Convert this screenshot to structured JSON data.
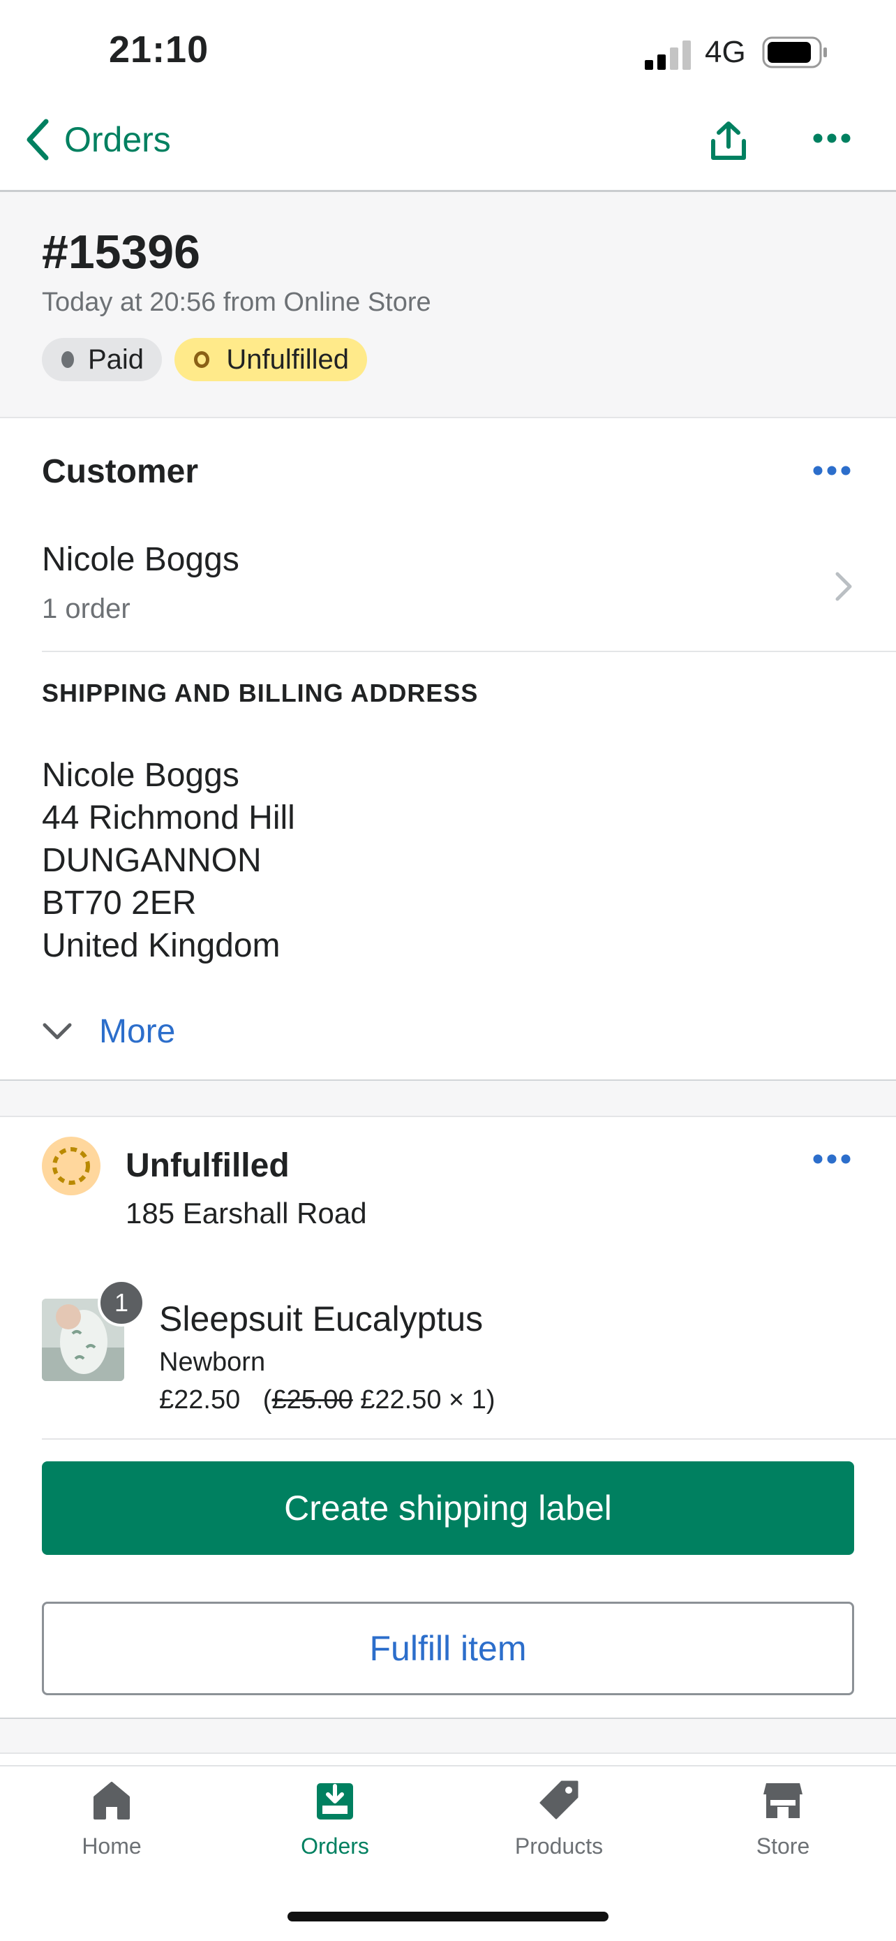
{
  "status_bar": {
    "time": "21:10",
    "network": "4G"
  },
  "nav": {
    "back_label": "Orders"
  },
  "order": {
    "number": "#15396",
    "meta": "Today at 20:56 from Online Store",
    "badges": {
      "paid": "Paid",
      "unfulfilled": "Unfulfilled"
    }
  },
  "customer": {
    "title": "Customer",
    "name": "Nicole Boggs",
    "orders": "1 order",
    "address_heading": "SHIPPING AND BILLING ADDRESS",
    "address": [
      "Nicole Boggs",
      "44 Richmond Hill",
      "DUNGANNON",
      "BT70 2ER",
      "United Kingdom"
    ],
    "more_label": "More"
  },
  "fulfillment": {
    "status": "Unfulfilled",
    "location": "185 Earshall Road",
    "item": {
      "quantity_badge": "1",
      "name": "Sleepsuit Eucalyptus",
      "variant": "Newborn",
      "price": "£22.50",
      "original_price": "£25.00",
      "unit_line": "£22.50 × 1"
    },
    "primary_button": "Create shipping label",
    "secondary_button": "Fulfill item"
  },
  "tabs": [
    {
      "label": "Home",
      "icon": "home-icon"
    },
    {
      "label": "Orders",
      "icon": "orders-icon",
      "active": true
    },
    {
      "label": "Products",
      "icon": "tag-icon"
    },
    {
      "label": "Store",
      "icon": "store-icon"
    }
  ],
  "colors": {
    "brand": "#008060",
    "link": "#2c6ecb",
    "unfulfilled_badge": "#ffea8a"
  }
}
